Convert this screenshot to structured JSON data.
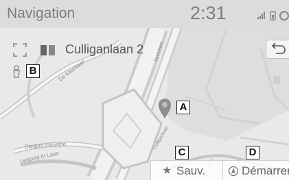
{
  "header": {
    "title": "Navigation",
    "time": "2:31"
  },
  "route": {
    "name": "Culliganlaan 2"
  },
  "map": {
    "streets": [
      "De Kleetlaan",
      "Diegem Industrie",
      "Leopold III Laan",
      "Culliganlaan",
      "Zaventem"
    ]
  },
  "callouts": [
    "A",
    "B",
    "C",
    "D"
  ],
  "actions": {
    "save_label": "Sauv.",
    "start_label": "Démarrer"
  },
  "icons": {
    "expand": "expand-icon",
    "person": "person-icon",
    "pin": "map-pin-icon",
    "back": "back-arrow-icon",
    "star": "star-icon",
    "start": "start-icon",
    "signal": "signal-icon",
    "battery": "battery-icon"
  },
  "colors": {
    "road": "#bdbdbd",
    "highway": "#a7a7a7",
    "pin": "#8e8e8e"
  }
}
